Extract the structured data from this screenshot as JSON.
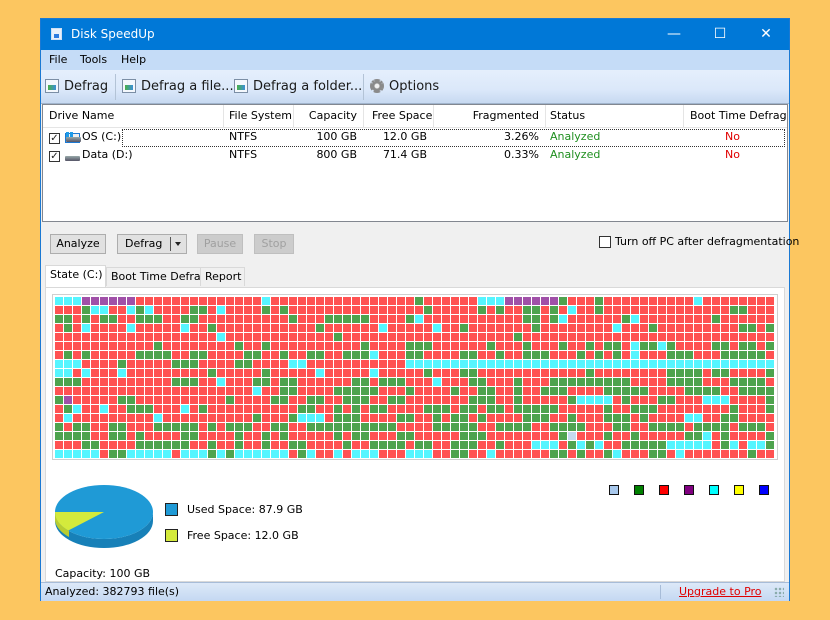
{
  "window": {
    "title": "Disk SpeedUp",
    "controls": {
      "minimize": "—",
      "maximize": "☐",
      "close": "✕"
    }
  },
  "menu": [
    "File",
    "Tools",
    "Help"
  ],
  "toolbar": {
    "defrag": "Defrag",
    "defrag_file": "Defrag a file...",
    "defrag_folder": "Defrag a folder...",
    "options": "Options"
  },
  "drives": {
    "columns": [
      "Drive Name",
      "File System",
      "Capacity",
      "Free Space",
      "Fragmented",
      "Status",
      "Boot Time Defrag"
    ],
    "rows": [
      {
        "checked": true,
        "icon": "system-drive-icon",
        "name": "OS (C:)",
        "fs": "NTFS",
        "capacity": "100 GB",
        "free": "12.0 GB",
        "fragmented": "3.26%",
        "status": "Analyzed",
        "boot": "No"
      },
      {
        "checked": true,
        "icon": "drive-icon",
        "name": "Data (D:)",
        "fs": "NTFS",
        "capacity": "800 GB",
        "free": "71.4 GB",
        "fragmented": "0.33%",
        "status": "Analyzed",
        "boot": "No"
      }
    ]
  },
  "actions": {
    "analyze": "Analyze",
    "defrag": "Defrag",
    "pause": "Pause",
    "stop": "Stop",
    "turn_off_label": "Turn off PC after defragmentation",
    "turn_off_checked": false
  },
  "tabs": [
    "State (C:)",
    "Boot Time Defrag",
    "Report"
  ],
  "cluster_map": {
    "colors": {
      "r": "#ff5252",
      "g": "#4ea34e",
      "c": "#55f5ff",
      "p": "#a050a8",
      "l": "#c6d9ee"
    },
    "rows": [
      "cccpppppprrrrrrrrrrrrrrcrrrrrrrrrrrrrrrrgrrrrrrcccppppppgrrrgrrrrrrrrrrcrrrrrrrrrrccrrrrgr",
      "rrrgccrrcgcrrrrggrcrrrrgrgrrrrrrrrrrrrrrrgrrrrrgrgrrggrgrcrrgrrrrrrrrrrrrrrggrrrgcrrrgr",
      "ggrgrggrrgggrrggrrrrrrrrrrgrrrgggggrrrrgcrrrrrrrrrrrggrgcrrrrrrgcrrrrrrrrgrrrrrrrrrrrrr",
      "rgrcrrrrcrrrrrcrrgrrrrrrrrrrrgrrrrrrcrrrrrcrrgrrrrrrrgrrrrrrrrcrrrgrrrrrrrrrggrggrrrrgr",
      "rrrrrrrrrrrrrrrrrrcrrrrrrrrrrrrgrrrrrrrrrrrrrrrrrrrgrrrrrrrrrrrrrrrrrrrrrrrrrrrrrrrrrr",
      "rrrrrrrrrrrgrrrrrrrrgrrgrrrrrrrrrrgrrrrgggrrrrrrgrrrgrrrgrrgrggrcggcgrrrrggrggrgrrrrgg",
      "rgrgrrrrrggggrrggrrrrggrrgrrggrrgggcrrrggrrrrggrrgrrgggrrrgrgrgrcrrrgggrrrgggggrrrrrgc",
      "cccrrrrgrrrrrgggrrrrggrrrrccrrrrrrrrrrrccccccccccccccccccccccccccccccccccccccccccccccc",
      "ccrcrrrcrrrrrrrrrgrrrrrgrrrrrcrrrrrcrrrrrgrrrggrrrrrrrrrrrrgrrrrrrrrggggrggrrrrgrrrrrr",
      "gggrrrrrrrrrrgggrrcrrrggrggrrrrrrggrgggrrrcrrrggrrrgrrrgggggggggrrrrggggrrrggggrrrggggg",
      "rrrrrrrrrrrrrrrrrrrrrrcrrggrrrrgggggrrrgrrrrgrrggrrgrrgggrrrrgggggrrrrggggrrggggggggggg",
      "gprrrrrggrrrrrrrrrrgrrrrggrrggrrgggrrggrrrrrrrgggrrgrrrrrgccccrgrrrggrrrcccrrrrgggrr",
      "rgcrrcrrgggrrrcrgrrrrrrrrrrggrrgrgrggrrrrgggrggrggrgggggrrrrrgrrgggrrrrrrrrgrrrgrrrgrrr",
      "rcrrrrrrrrrcrrrrrrrrrrgrrrgcccrgggrrrrggrrgrggrgrrrrgggrrgrrrgggrgrrrrccrrggrrrrrcgrrrg",
      "grggrrggrrrgggggrgrgggrrggrrggggggggggrrrrgggggrrggggrrggggrrrggrrggggrggggrgggrggg",
      "ggggrrggrgrrrrggrrrrgrrgrgrrrrrgrggrrrggrrrrrgggrrrrrrrrglrrrgrrgrrrrrggcrgrrrrgrrrrr",
      "rrrggrrrrggggggrrgrrgrrgrrggrrrrgrrggggrggrrgggrrgrrrcccrgcgcrrgggggcccccrgcrccgcccrcc",
      "cccccrggcccccrcccgcgccccccrgcrrcrcccrrrcccrrggrrcrrrrrrggrgrrgcrrrggrcrrrrrrrgrrrrgrrg"
    ]
  },
  "legend_swatches": [
    {
      "name": "free-clusters",
      "color": "#a8c8ec"
    },
    {
      "name": "not-fragmented",
      "color": "#008000"
    },
    {
      "name": "fragmented",
      "color": "#ff0000"
    },
    {
      "name": "system",
      "color": "#800080"
    },
    {
      "name": "directories",
      "color": "#00ffff"
    },
    {
      "name": "being-processed",
      "color": "#ffff00"
    },
    {
      "name": "mft",
      "color": "#0000ff"
    }
  ],
  "usage": {
    "used_label": "Used Space: 87.9 GB",
    "free_label": "Free Space: 12.0 GB",
    "capacity_label": "Capacity: 100 GB",
    "used_gb": 87.9,
    "free_gb": 12.0,
    "used_color": "#1f9ad6",
    "free_color": "#d4ea3c"
  },
  "statusbar": {
    "text": "Analyzed: 382793 file(s)",
    "upgrade": "Upgrade to Pro"
  }
}
